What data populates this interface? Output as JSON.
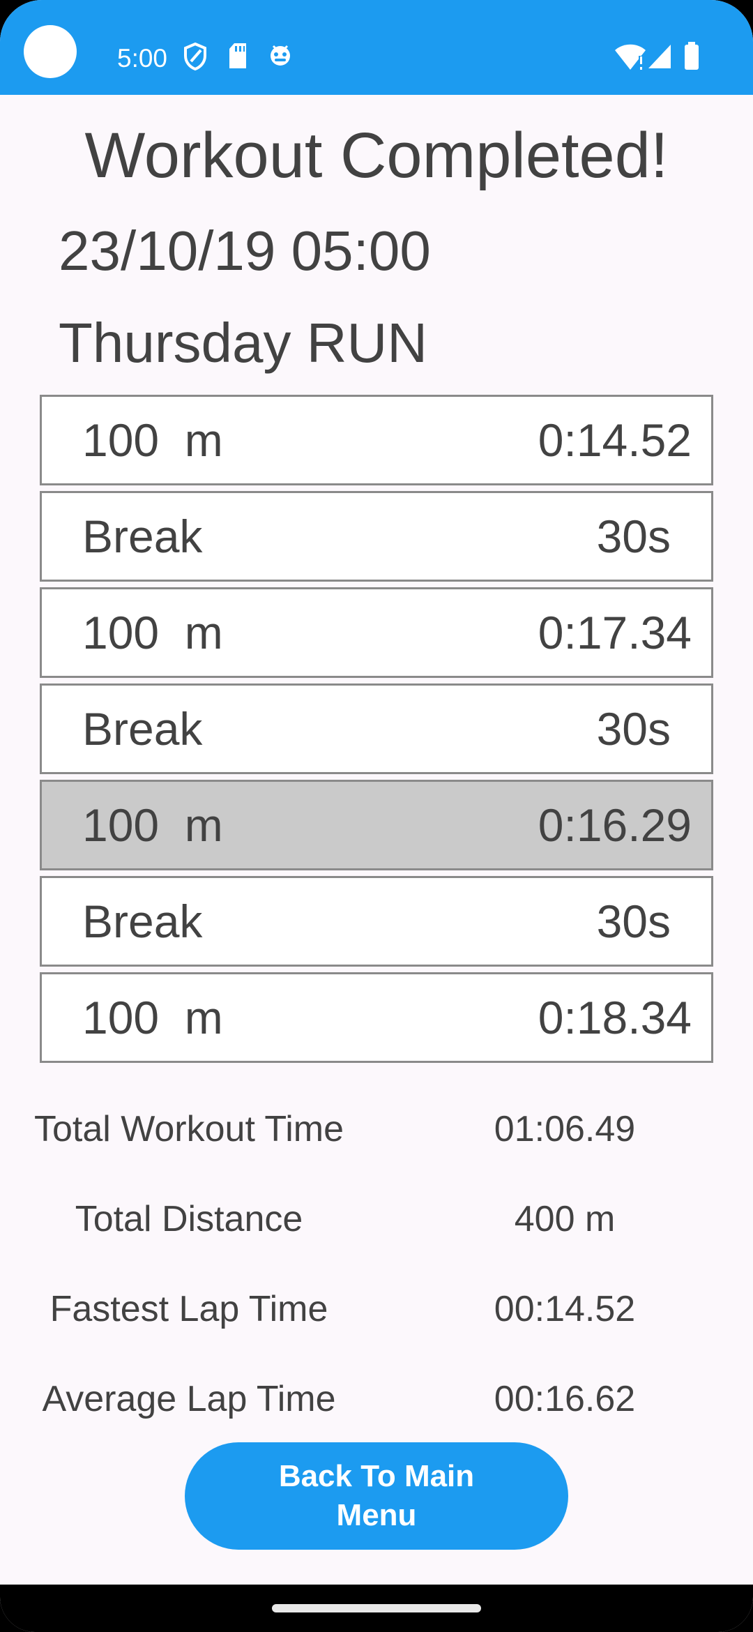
{
  "status_bar": {
    "time": "5:00",
    "icons": [
      "shield-icon",
      "sd-card-icon",
      "android-debug-icon",
      "wifi-alert-icon",
      "signal-icon",
      "battery-icon"
    ]
  },
  "header": {
    "title": "Workout Completed!",
    "date": "23/10/19 05:00",
    "workout_name": "Thursday RUN"
  },
  "laps": [
    {
      "label": "100  m",
      "value": "0:14.52",
      "kind": "lap",
      "selected": false
    },
    {
      "label": "Break",
      "value": "30s",
      "kind": "break",
      "selected": false
    },
    {
      "label": "100  m",
      "value": "0:17.34",
      "kind": "lap",
      "selected": false
    },
    {
      "label": "Break",
      "value": "30s",
      "kind": "break",
      "selected": false
    },
    {
      "label": "100  m",
      "value": "0:16.29",
      "kind": "lap",
      "selected": true
    },
    {
      "label": "Break",
      "value": "30s",
      "kind": "break",
      "selected": false
    },
    {
      "label": "100  m",
      "value": "0:18.34",
      "kind": "lap",
      "selected": false
    }
  ],
  "stats": [
    {
      "label": "Total Workout Time",
      "value": "01:06.49"
    },
    {
      "label": "Total Distance",
      "value": "400 m"
    },
    {
      "label": "Fastest Lap Time",
      "value": "00:14.52"
    },
    {
      "label": "Average Lap Time",
      "value": "00:16.62"
    }
  ],
  "back_button": {
    "label": "Back To Main Menu"
  },
  "colors": {
    "accent": "#1c9bf0",
    "background": "#fcf8fc",
    "text": "#424242",
    "selected_row": "#cacaca"
  }
}
